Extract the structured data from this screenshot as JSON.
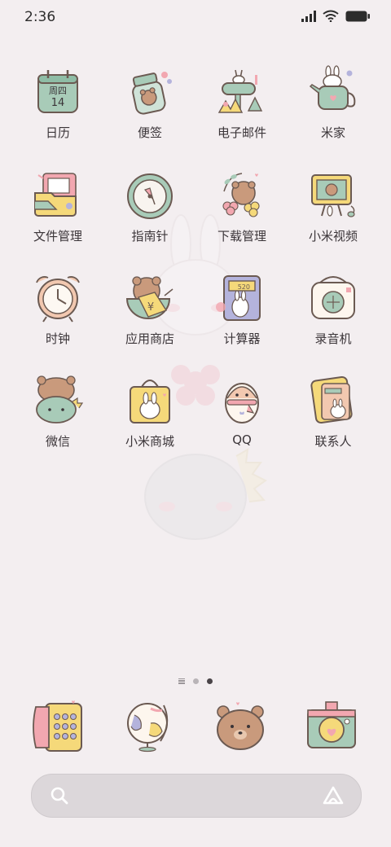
{
  "status": {
    "time": "2:36",
    "icons": [
      "signal-icon",
      "wifi-icon",
      "battery-icon"
    ]
  },
  "apps": [
    {
      "label": "日历",
      "icon": "calendar-icon",
      "calendar_weekday": "周四",
      "calendar_day": "14"
    },
    {
      "label": "便签",
      "icon": "notes-jar-icon"
    },
    {
      "label": "电子邮件",
      "icon": "mailbox-icon"
    },
    {
      "label": "米家",
      "icon": "watering-can-icon"
    },
    {
      "label": "文件管理",
      "icon": "folder-icon"
    },
    {
      "label": "指南针",
      "icon": "compass-icon"
    },
    {
      "label": "下载管理",
      "icon": "flower-bear-icon"
    },
    {
      "label": "小米视频",
      "icon": "tv-icon"
    },
    {
      "label": "时钟",
      "icon": "alarm-clock-icon"
    },
    {
      "label": "应用商店",
      "icon": "bear-bowl-icon"
    },
    {
      "label": "计算器",
      "icon": "calculator-icon",
      "calculator_display": "520"
    },
    {
      "label": "录音机",
      "icon": "recorder-icon"
    },
    {
      "label": "微信",
      "icon": "bear-dino-icon"
    },
    {
      "label": "小米商城",
      "icon": "shopping-bag-icon"
    },
    {
      "label": "QQ",
      "icon": "penguin-icon"
    },
    {
      "label": "联系人",
      "icon": "contacts-book-icon"
    }
  ],
  "page_indicator": {
    "pages": 2,
    "current": 2
  },
  "dock": [
    {
      "icon": "phone-dialer-icon"
    },
    {
      "icon": "globe-browser-icon"
    },
    {
      "icon": "bear-face-icon"
    },
    {
      "icon": "camera-icon"
    }
  ],
  "colors": {
    "background": "#f3eef0",
    "mint": "#a8cbb8",
    "pink": "#f2a7b0",
    "yellow": "#f5d97a",
    "brown": "#c99a7c",
    "lavender": "#b4b3dc",
    "outline": "#7a5a52"
  }
}
